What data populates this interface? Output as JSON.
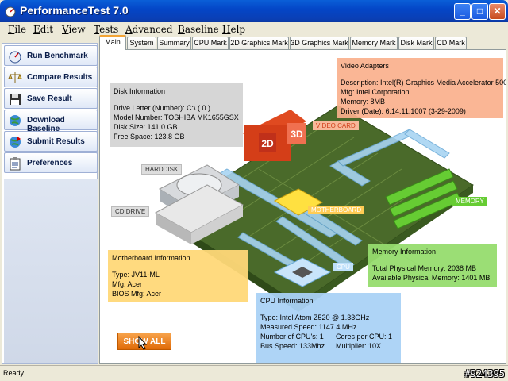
{
  "window": {
    "title": "PerformanceTest 7.0"
  },
  "menu": [
    {
      "pre": "",
      "u": "F",
      "post": "ile"
    },
    {
      "pre": "",
      "u": "E",
      "post": "dit"
    },
    {
      "pre": "",
      "u": "V",
      "post": "iew"
    },
    {
      "pre": "",
      "u": "T",
      "post": "ests"
    },
    {
      "pre": "",
      "u": "A",
      "post": "dvanced"
    },
    {
      "pre": "",
      "u": "B",
      "post": "aseline"
    },
    {
      "pre": "",
      "u": "H",
      "post": "elp"
    }
  ],
  "sidebar": {
    "items": [
      {
        "label": "Run Benchmark",
        "icon": "speedometer-icon"
      },
      {
        "label": "Compare Results",
        "icon": "scales-icon"
      },
      {
        "label": "Save Result",
        "icon": "floppy-disk-icon"
      },
      {
        "label": "Download Baseline",
        "icon": "globe-download-icon"
      },
      {
        "label": "Submit Results",
        "icon": "globe-upload-icon"
      },
      {
        "label": "Preferences",
        "icon": "clipboard-icon"
      }
    ]
  },
  "tabs": [
    "Main",
    "System",
    "Summary",
    "CPU Mark",
    "2D Graphics Mark",
    "3D Graphics Mark",
    "Memory Mark",
    "Disk Mark",
    "CD Mark"
  ],
  "disk": {
    "heading": "Disk Information",
    "rows": [
      "Drive Letter (Number): C:\\ ( 0 )",
      "Model Number: TOSHIBA MK1655GSX",
      "Disk Size: 141.0 GB",
      "Free Space: 123.8 GB"
    ]
  },
  "video": {
    "heading": "Video Adapters",
    "rows": [
      "Description: Intel(R) Graphics Media Accelerator 500",
      "Mfg: Intel Corporation",
      "Memory: 8MB",
      "Driver (Date): 6.14.11.1007 (3-29-2009)"
    ]
  },
  "mobo": {
    "heading": "Motherboard Information",
    "rows": [
      "Type: JV11-ML",
      "Mfg: Acer",
      "BIOS Mfg: Acer"
    ]
  },
  "memory": {
    "heading": "Memory Information",
    "rows": [
      "Total Physical Memory: 2038 MB",
      "Available Physical Memory: 1401 MB"
    ]
  },
  "cpu": {
    "heading": "CPU Information",
    "rows": [
      "Type: Intel Atom Z520 @ 1.33GHz",
      "Measured Speed: 1147.4 MHz"
    ],
    "row3a": "Number of CPU's: 1",
    "row3b": "Cores per CPU: 1",
    "row4a": "Bus Speed: 133Mhz",
    "row4b": "Multiplier: 10X"
  },
  "labels": {
    "harddisk": "HARDDISK",
    "cddrive": "CD DRIVE",
    "videocard": "VIDEO CARD",
    "motherboard": "MOTHERBOARD",
    "memory": "MEMORY",
    "cpu": "CPU",
    "chip2d": "2D",
    "chip3d": "3D"
  },
  "show_all": "SHOW ALL",
  "status": {
    "text": "Ready"
  },
  "watermark": "#924395",
  "colors": {
    "titlebar": "#0a5fd8",
    "accent_orange": "#e06b08",
    "board_green": "#4a6a2a"
  }
}
